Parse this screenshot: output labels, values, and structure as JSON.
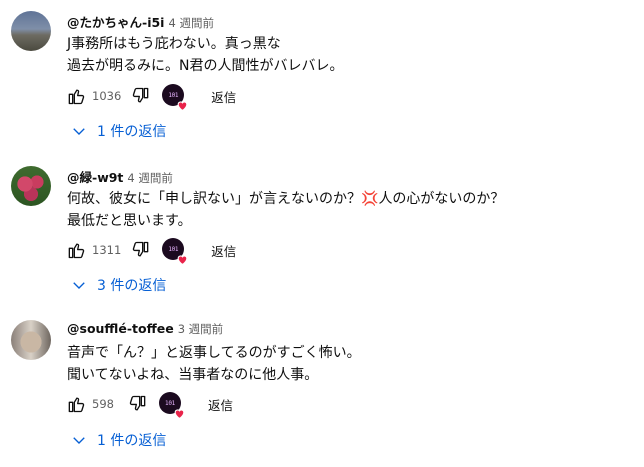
{
  "comments": [
    {
      "author": "@たかちゃん-i5i",
      "time": "4 週間前",
      "lines": [
        "J事務所はもう庇わない。真っ黒な",
        "過去が明るみに。N君の人間性がバレバレ。"
      ],
      "likes": "1036",
      "reply_label": "返信",
      "replies_label": "1 件の返信",
      "avatar_icon": "landscape-avatar"
    },
    {
      "author": "@緑-w9t",
      "time": "4 週間前",
      "lines": [
        "何故、彼女に「申し訳ない」が言えないのか？",
        "人の心がないのか？",
        "最低だと思います。"
      ],
      "emoji": "💢",
      "likes": "1311",
      "reply_label": "返信",
      "replies_label": "3 件の返信",
      "avatar_icon": "flower-avatar"
    },
    {
      "author": "@soufflé-toffee",
      "time": "3 週間前",
      "lines": [
        "音声で「ん？」と返事してるのがすごく怖い。",
        "聞いてないよね、当事者なのに他人事。"
      ],
      "likes": "598",
      "reply_label": "返信",
      "replies_label": "1 件の返信",
      "avatar_icon": "cat-avatar"
    }
  ],
  "creator_avatar_text": "101",
  "colors": {
    "link": "#065fd4",
    "heart": "#e9234a",
    "muted": "#606060"
  }
}
